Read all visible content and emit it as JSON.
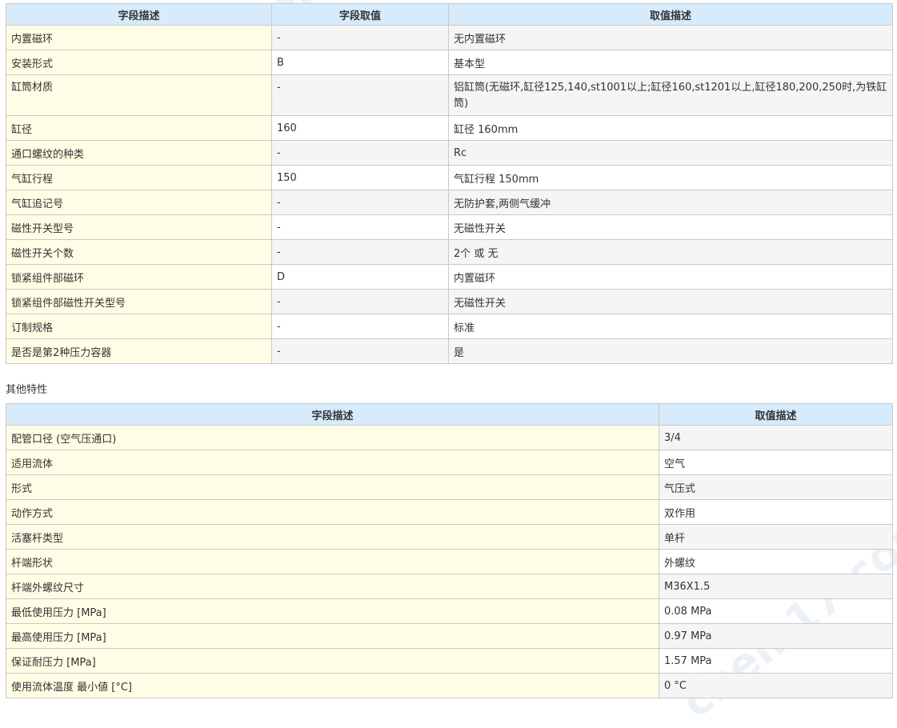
{
  "table1": {
    "headers": [
      "字段描述",
      "字段取值",
      "取值描述"
    ],
    "rows": [
      {
        "label": "内置磁环",
        "value": "-",
        "desc": "无内置磁环"
      },
      {
        "label": "安装形式",
        "value": "B",
        "desc": "基本型"
      },
      {
        "label": "缸筒材质",
        "value": "-",
        "desc": "铝缸筒(无磁环,缸径125,140,st1001以上;缸径160,st1201以上,缸径180,200,250时,为铁缸筒)"
      },
      {
        "label": "缸径",
        "value": "160",
        "desc": "缸径 160mm"
      },
      {
        "label": "通口螺纹的种类",
        "value": "-",
        "desc": "Rc"
      },
      {
        "label": "气缸行程",
        "value": "150",
        "desc": "气缸行程 150mm"
      },
      {
        "label": "气缸追记号",
        "value": "-",
        "desc": "无防护套,两侧气缓冲"
      },
      {
        "label": "磁性开关型号",
        "value": "-",
        "desc": "无磁性开关"
      },
      {
        "label": "磁性开关个数",
        "value": "-",
        "desc": "2个 或 无"
      },
      {
        "label": "锁紧组件部磁环",
        "value": "D",
        "desc": "内置磁环"
      },
      {
        "label": "锁紧组件部磁性开关型号",
        "value": "-",
        "desc": "无磁性开关"
      },
      {
        "label": "订制规格",
        "value": "-",
        "desc": "标准"
      },
      {
        "label": "是否是第2种压力容器",
        "value": "-",
        "desc": "是"
      }
    ]
  },
  "section2_title": "其他特性",
  "table2": {
    "headers": [
      "字段描述",
      "取值描述"
    ],
    "rows": [
      {
        "label": "配管口径 (空气压通口)",
        "desc": "3/4"
      },
      {
        "label": "适用流体",
        "desc": "空气"
      },
      {
        "label": "形式",
        "desc": "气压式"
      },
      {
        "label": "动作方式",
        "desc": "双作用"
      },
      {
        "label": "活塞杆类型",
        "desc": "单杆"
      },
      {
        "label": "杆端形状",
        "desc": "外螺纹"
      },
      {
        "label": "杆端外螺纹尺寸",
        "desc": "M36X1.5"
      },
      {
        "label": "最低使用压力 [MPa]",
        "desc": "0.08 MPa"
      },
      {
        "label": "最高使用压力 [MPa]",
        "desc": "0.97 MPa"
      },
      {
        "label": "保证耐压力 [MPa]",
        "desc": "1.57 MPa"
      },
      {
        "label": "使用流体温度 最小値 [°C]",
        "desc": "0 °C"
      }
    ]
  },
  "watermark": "chem17.com"
}
